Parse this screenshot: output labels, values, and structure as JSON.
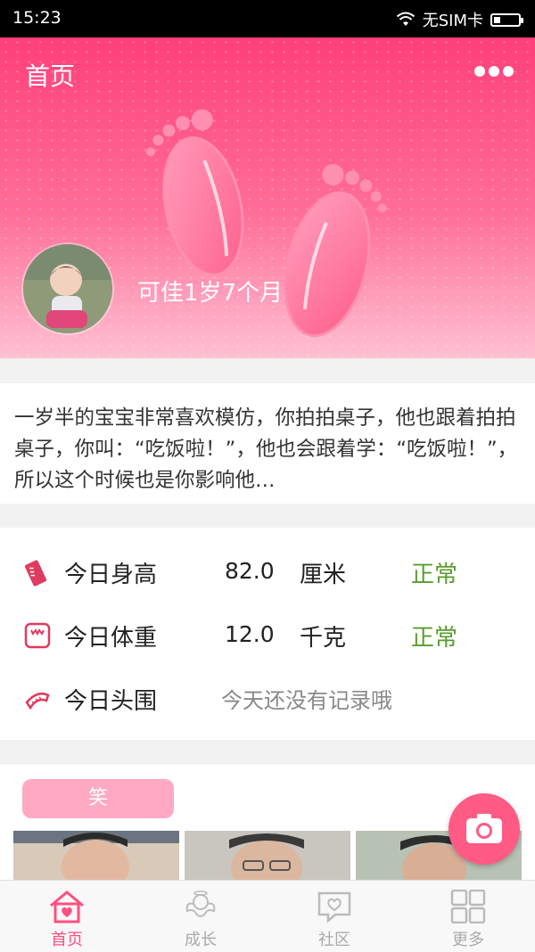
{
  "status_bar": {
    "time": "15:23",
    "carrier": "无SIM卡"
  },
  "header": {
    "title": "首页",
    "baby_name": "可佳1岁7个月"
  },
  "tip": {
    "text": "一岁半的宝宝非常喜欢模仿，你拍拍桌子，他也跟着拍拍桌子，你叫：“吃饭啦！”，他也会跟着学：“吃饭啦！”，所以这个时候也是你影响他…"
  },
  "measurements": {
    "height": {
      "label": "今日身高",
      "value": "82.0",
      "unit": "厘米",
      "status": "正常"
    },
    "weight": {
      "label": "今日体重",
      "value": "12.0",
      "unit": "千克",
      "status": "正常"
    },
    "head": {
      "label": "今日头围",
      "empty_text": "今天还没有记录哦"
    }
  },
  "album": {
    "tag": "笑"
  },
  "tabs": [
    {
      "label": "首页",
      "icon": "home-icon",
      "active": true
    },
    {
      "label": "成长",
      "icon": "angel-icon",
      "active": false
    },
    {
      "label": "社区",
      "icon": "heart-chat-icon",
      "active": false
    },
    {
      "label": "更多",
      "icon": "grid-icon",
      "active": false
    }
  ],
  "colors": {
    "primary": "#ff4f7f",
    "normal_status": "#5a9c2c",
    "pill": "#ffa9c3"
  }
}
